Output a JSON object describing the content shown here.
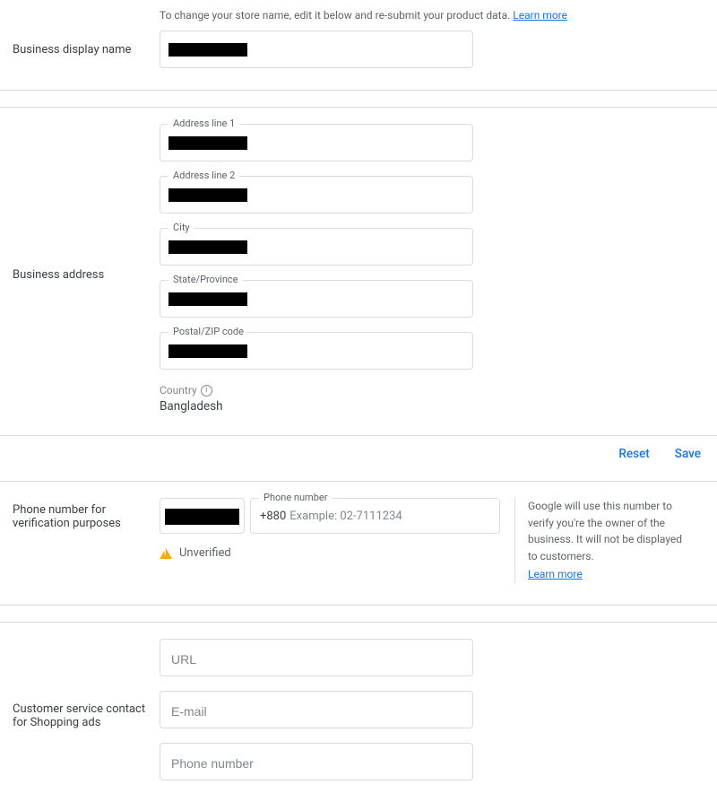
{
  "display_name": {
    "helper": "To change your store name, edit it below and re-submit your product data.",
    "learn_more": "Learn more",
    "label": "Business display name"
  },
  "address": {
    "label": "Business address",
    "line1_label": "Address line 1",
    "line2_label": "Address line 2",
    "city_label": "City",
    "state_label": "State/Province",
    "postal_label": "Postal/ZIP code",
    "country_label": "Country",
    "country_value": "Bangladesh"
  },
  "actions": {
    "reset": "Reset",
    "save": "Save"
  },
  "phone": {
    "label": "Phone number for verification purposes",
    "field_label": "Phone number",
    "prefix": "+880",
    "placeholder": "Example: 02-7111234",
    "status": "Unverified",
    "note": "Google will use this number to verify you're the owner of the business. It will not be displayed to customers.",
    "learn_more": "Learn more"
  },
  "customer_service": {
    "label": "Customer service contact for Shopping ads",
    "url_placeholder": "URL",
    "email_placeholder": "E-mail",
    "phone_placeholder": "Phone number"
  }
}
